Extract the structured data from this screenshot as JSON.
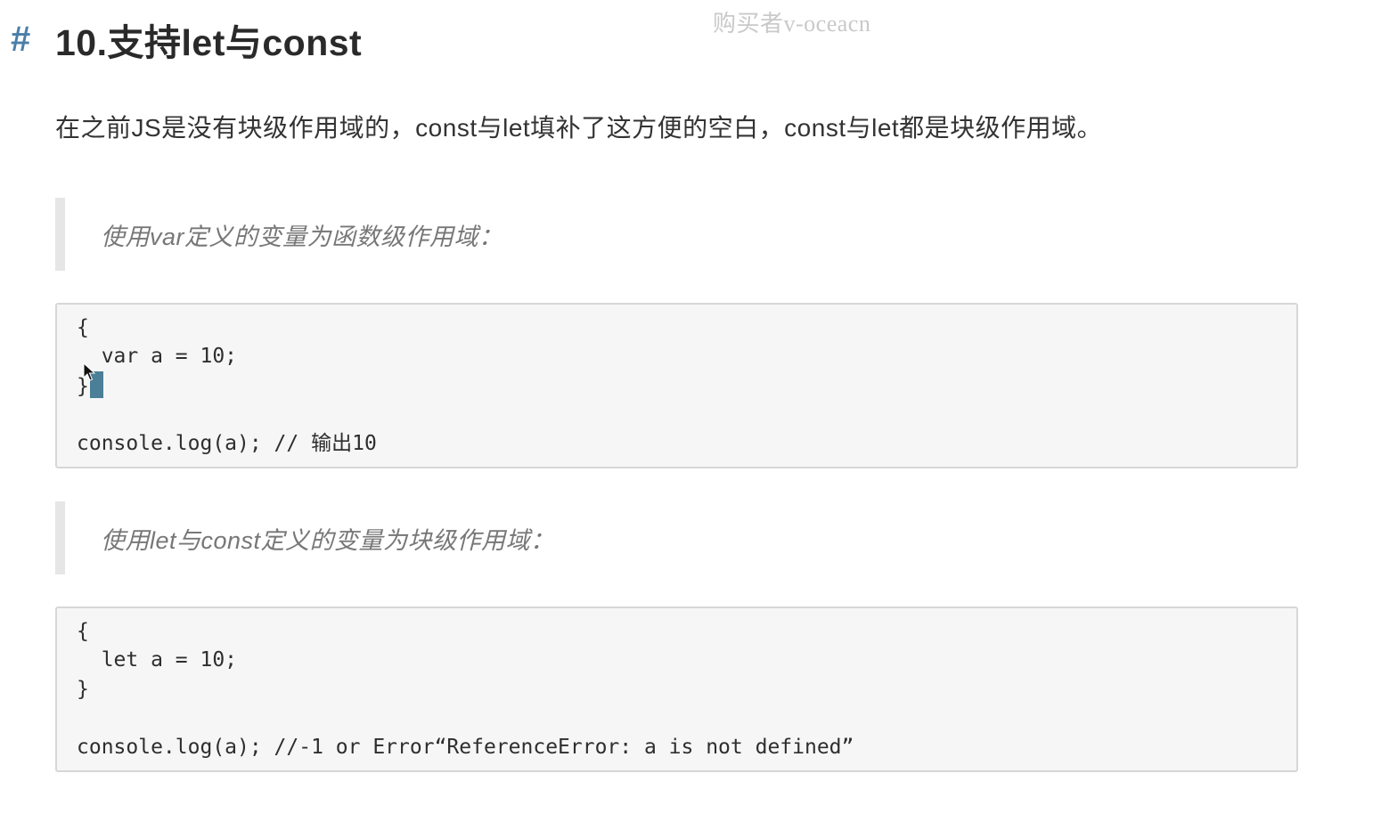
{
  "watermark": "购买者v-oceacn",
  "heading": {
    "hash": "#",
    "title": "10.支持let与const"
  },
  "intro": "在之前JS是没有块级作用域的，const与let填补了这方便的空白，const与let都是块级作用域。",
  "quote1": "使用var定义的变量为函数级作用域：",
  "code1": {
    "lines": [
      "{",
      "  var a = 10;",
      "}",
      "",
      "console.log(a); // 输出10"
    ]
  },
  "quote2": "使用let与const定义的变量为块级作用域：",
  "code2": {
    "lines": [
      "{",
      "  let a = 10;",
      "}",
      "",
      "console.log(a); //-1 or Error“ReferenceError: a is not defined”"
    ]
  }
}
